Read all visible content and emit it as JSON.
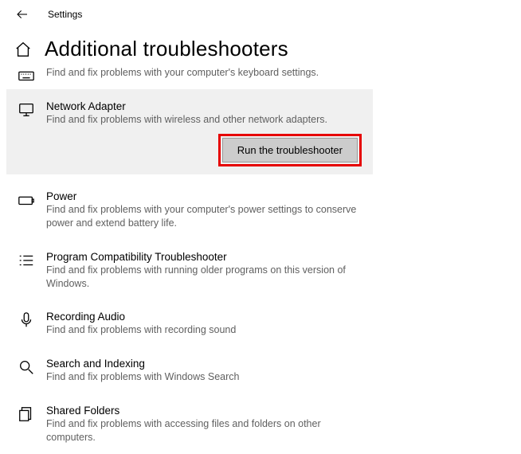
{
  "window": {
    "title": "Settings"
  },
  "page": {
    "title": "Additional troubleshooters"
  },
  "run_button": {
    "label": "Run the troubleshooter"
  },
  "items": [
    {
      "title": "Keyboard",
      "desc": "Find and fix problems with your computer's keyboard settings."
    },
    {
      "title": "Network Adapter",
      "desc": "Find and fix problems with wireless and other network adapters."
    },
    {
      "title": "Power",
      "desc": "Find and fix problems with your computer's power settings to conserve power and extend battery life."
    },
    {
      "title": "Program Compatibility Troubleshooter",
      "desc": "Find and fix problems with running older programs on this version of Windows."
    },
    {
      "title": "Recording Audio",
      "desc": "Find and fix problems with recording sound"
    },
    {
      "title": "Search and Indexing",
      "desc": "Find and fix problems with Windows Search"
    },
    {
      "title": "Shared Folders",
      "desc": "Find and fix problems with accessing files and folders on other computers."
    }
  ]
}
